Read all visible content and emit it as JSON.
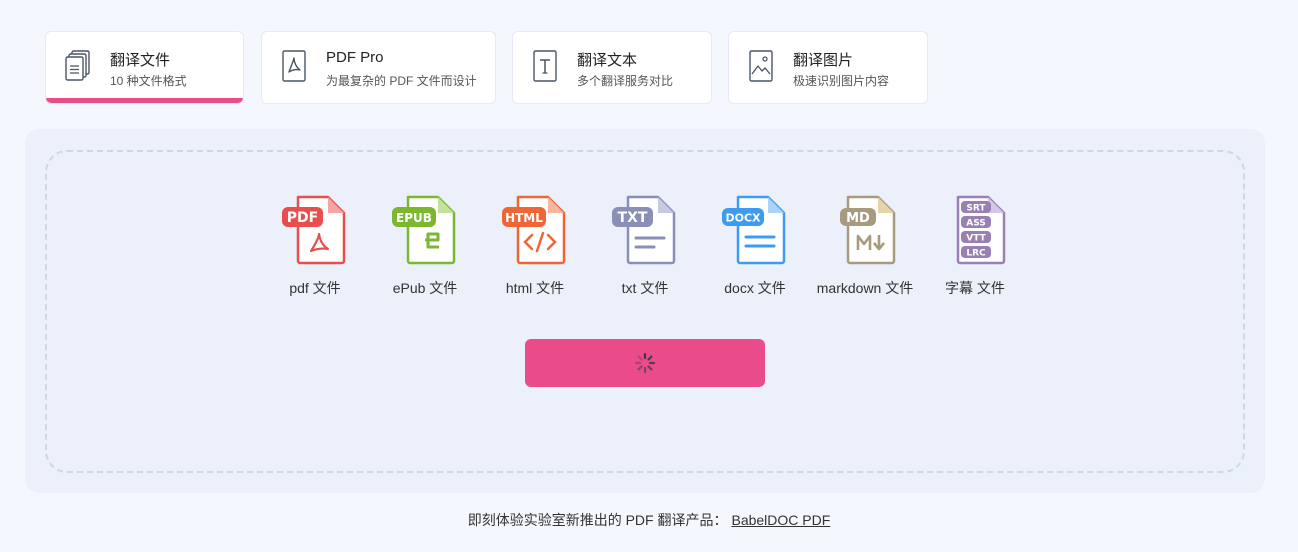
{
  "tabs": [
    {
      "title": "翻译文件",
      "subtitle": "10 种文件格式",
      "active": true,
      "icon": "documents-icon"
    },
    {
      "title": "PDF Pro",
      "subtitle": "为最复杂的 PDF 文件而设计",
      "active": false,
      "icon": "pdf-icon"
    },
    {
      "title": "翻译文本",
      "subtitle": "多个翻译服务对比",
      "active": false,
      "icon": "text-icon"
    },
    {
      "title": "翻译图片",
      "subtitle": "极速识别图片内容",
      "active": false,
      "icon": "image-icon"
    }
  ],
  "file_types": [
    {
      "badge": "PDF",
      "label": "pdf 文件",
      "color": "#e94e4e",
      "icon": "pdf-file-icon"
    },
    {
      "badge": "EPUB",
      "label": "ePub 文件",
      "color": "#7cb82f",
      "icon": "epub-file-icon"
    },
    {
      "badge": "HTML",
      "label": "html 文件",
      "color": "#ef6535",
      "icon": "html-file-icon"
    },
    {
      "badge": "TXT",
      "label": "txt 文件",
      "color": "#8a8fb8",
      "icon": "txt-file-icon"
    },
    {
      "badge": "DOCX",
      "label": "docx 文件",
      "color": "#3d9cf0",
      "icon": "docx-file-icon"
    },
    {
      "badge": "MD",
      "label": "markdown 文件",
      "color": "#a89a7f",
      "icon": "markdown-file-icon"
    },
    {
      "badges": [
        "SRT",
        "ASS",
        "VTT",
        "LRC"
      ],
      "label": "字幕 文件",
      "color": "#9a7fb3",
      "icon": "subtitle-file-icon"
    }
  ],
  "upload_button": {
    "state": "loading",
    "color": "#ea4c89"
  },
  "footer": {
    "text": "即刻体验实验室新推出的 PDF 翻译产品：",
    "link_text": "BabelDOC PDF"
  },
  "colors": {
    "accent": "#ea4c89",
    "background": "#f4f7fd",
    "panel": "#ebf0fa"
  }
}
